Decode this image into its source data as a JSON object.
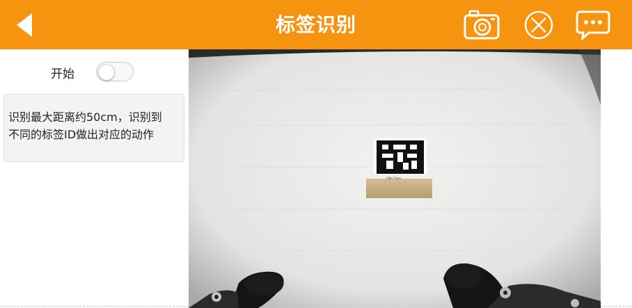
{
  "header": {
    "title": "标签识别",
    "back_icon": "back-arrow-icon",
    "actions": [
      {
        "name": "camera",
        "icon": "camera-icon"
      },
      {
        "name": "close",
        "icon": "close-circle-icon"
      },
      {
        "name": "chat",
        "icon": "chat-bubble-icon"
      }
    ],
    "color": "#f6930f"
  },
  "left_panel": {
    "start_label": "开始",
    "start_toggle_on": false,
    "info_line1": "识别最大距离约50cm，识别到",
    "info_line2": "不同的标签ID做出对应的动作"
  },
  "camera_view": {
    "description_icon": "camera-feed-image"
  }
}
